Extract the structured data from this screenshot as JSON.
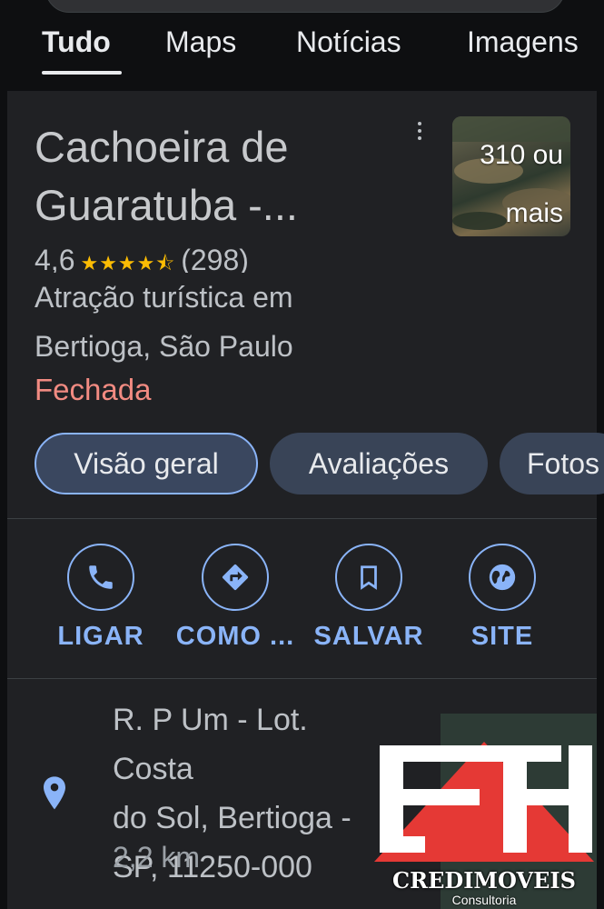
{
  "tabs": [
    {
      "label": "Tudo",
      "active": true
    },
    {
      "label": "Maps"
    },
    {
      "label": "Notícias"
    },
    {
      "label": "Imagens"
    }
  ],
  "place": {
    "title_line1": "Cachoeira de",
    "title_line2": "Guaratuba -...",
    "thumbnail_line1": "310 ou",
    "thumbnail_line2": "mais",
    "rating": "4,6",
    "stars_shown": 4.5,
    "reviews": "(298)",
    "category_line1": "Atração turística em",
    "category_line2": "Bertioga, São Paulo",
    "status": "Fechada"
  },
  "chips": [
    "Visão geral",
    "Avaliações",
    "Fotos"
  ],
  "actions": [
    {
      "label": "LIGAR",
      "icon": "phone-icon"
    },
    {
      "label": "COMO ...",
      "icon": "directions-icon"
    },
    {
      "label": "SALVAR",
      "icon": "bookmark-icon"
    },
    {
      "label": "SITE",
      "icon": "globe-icon"
    }
  ],
  "address": {
    "line1": "R. P Um - Lot. Costa",
    "line2": "do Sol, Bertioga -",
    "line3": "SP, 11250-000",
    "distance": "2,2 km"
  },
  "watermark": {
    "name": "CREDIMOVEIS",
    "subtitle": "Consultoria"
  },
  "colors": {
    "accent": "#8ab4f8",
    "status_closed": "#f28b82",
    "star": "#fbbc04",
    "logo_red": "#e53935"
  }
}
